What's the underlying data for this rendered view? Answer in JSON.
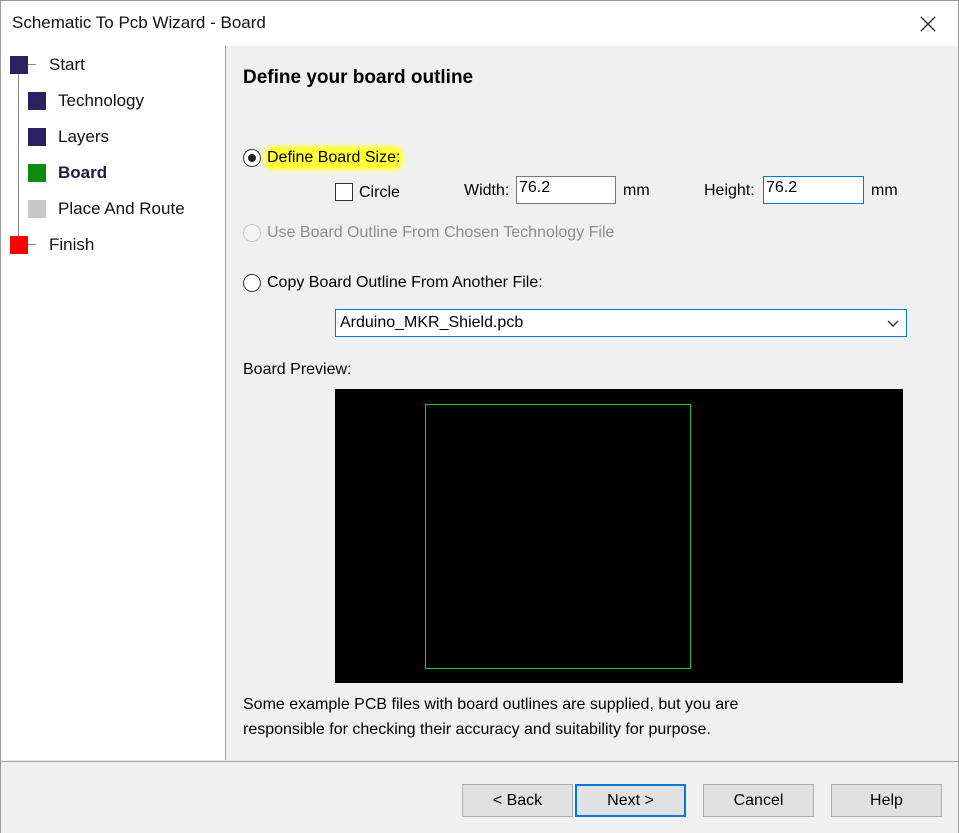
{
  "window": {
    "title": "Schematic To Pcb Wizard - Board"
  },
  "steps": [
    {
      "label": "Start",
      "color": "#2b2160"
    },
    {
      "label": "Technology",
      "color": "#2b2160"
    },
    {
      "label": "Layers",
      "color": "#2b2160"
    },
    {
      "label": "Board",
      "color": "#108a10",
      "current": true
    },
    {
      "label": "Place And Route",
      "color": "#c8c8c8"
    },
    {
      "label": "Finish",
      "color": "#ff0000"
    }
  ],
  "main": {
    "heading": "Define your board outline",
    "define_size": {
      "label": "Define Board Size:",
      "selected": true,
      "circle_label": "Circle",
      "circle_checked": false,
      "width_label": "Width:",
      "width_value": "76.2",
      "width_unit": "mm",
      "height_label": "Height:",
      "height_value": "76.2",
      "height_unit": "mm"
    },
    "use_tech_outline": {
      "label": "Use Board Outline From Chosen Technology File",
      "enabled": false
    },
    "copy_outline": {
      "label": "Copy Board Outline From Another File:",
      "selected": false,
      "file": "Arduino_MKR_Shield.pcb"
    },
    "preview_label": "Board Preview:",
    "preview_colors": {
      "background": "#000000",
      "outline": "#22c72b"
    },
    "note_line1": "Some example PCB files with board outlines are supplied, but you are",
    "note_line2": "responsible for checking their accuracy and suitability for purpose."
  },
  "buttons": {
    "back": "< Back",
    "next": "Next >",
    "cancel": "Cancel",
    "help": "Help"
  },
  "highlight_color": "#ffff33"
}
